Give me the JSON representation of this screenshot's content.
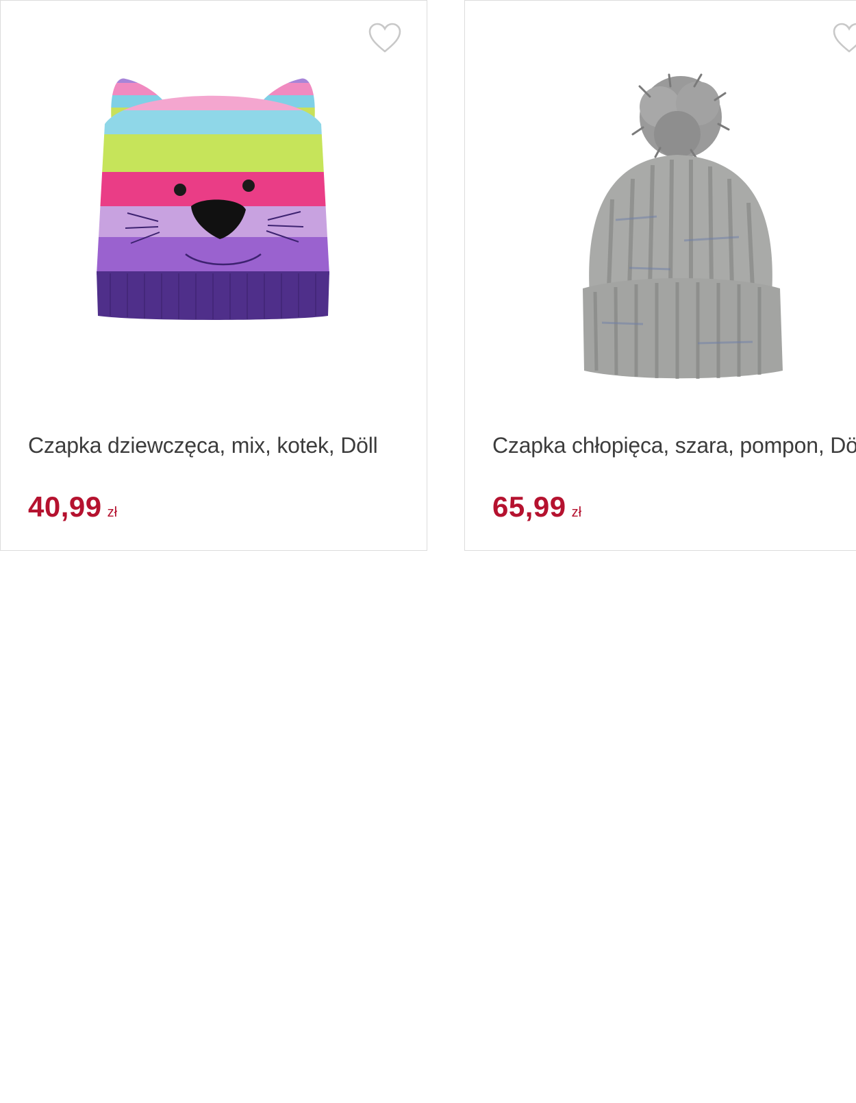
{
  "colors": {
    "price": "#b5122f",
    "text": "#3c3c3c",
    "border": "#dcdcdc",
    "heart": "#c8c8c8"
  },
  "products": [
    {
      "name": "Czapka dziewczęca, mix, kotek, Döll",
      "price": "40,99",
      "currency": "zł",
      "image": "striped-cat-hat-image",
      "favorite_icon": "heart-outline-icon"
    },
    {
      "name": "Czapka chłopięca, szara, pompon, Döll",
      "price": "65,99",
      "currency": "zł",
      "image": "grey-pompon-hat-image",
      "favorite_icon": "heart-outline-icon"
    }
  ]
}
